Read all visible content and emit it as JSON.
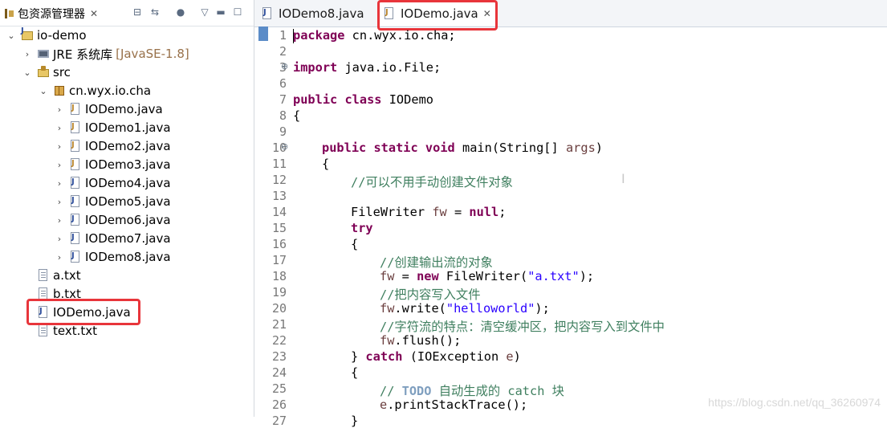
{
  "explorer": {
    "title": "包资源管理器",
    "tree": [
      {
        "label": "io-demo"
      },
      {
        "label": "JRE 系统库",
        "suffix": "[JavaSE-1.8]"
      },
      {
        "label": "src"
      },
      {
        "label": "cn.wyx.io.cha"
      },
      {
        "label": "IODemo.java"
      },
      {
        "label": "IODemo1.java"
      },
      {
        "label": "IODemo2.java"
      },
      {
        "label": "IODemo3.java"
      },
      {
        "label": "IODemo4.java"
      },
      {
        "label": "IODemo5.java"
      },
      {
        "label": "IODemo6.java"
      },
      {
        "label": "IODemo7.java"
      },
      {
        "label": "IODemo8.java"
      },
      {
        "label": "a.txt"
      },
      {
        "label": "b.txt"
      },
      {
        "label": "IODemo.java"
      },
      {
        "label": "text.txt"
      }
    ]
  },
  "editor": {
    "tabs": [
      {
        "label": "IODemo8.java"
      },
      {
        "label": "IODemo.java"
      }
    ],
    "line_numbers": [
      "1",
      "2",
      "3",
      "6",
      "7",
      "8",
      "9",
      "10",
      "11",
      "12",
      "13",
      "14",
      "15",
      "16",
      "17",
      "18",
      "19",
      "20",
      "21",
      "22",
      "23",
      "24",
      "25",
      "26",
      "27"
    ],
    "code": {
      "l1_kw": "package",
      "l1_rest": " cn.wyx.io.cha;",
      "l3_kw": "import",
      "l3_rest": " java.io.File;",
      "l7_kw": "public class",
      "l7_rest": " IODemo",
      "l8": "{",
      "l10_kw": "public static void",
      "l10_a": " main(String[] ",
      "l10_var": "args",
      "l10_b": ")",
      "l11": "{",
      "l12": "//可以不用手动创建文件对象",
      "l14_a": "FileWriter ",
      "l14_var": "fw",
      "l14_b": " = ",
      "l14_kw": "null",
      "l14_c": ";",
      "l15": "try",
      "l16": "{",
      "l17": "//创建输出流的对象",
      "l18_var": "fw",
      "l18_a": " = ",
      "l18_kw": "new",
      "l18_b": " FileWriter(",
      "l18_str": "\"a.txt\"",
      "l18_c": ");",
      "l19": "//把内容写入文件",
      "l20_var": "fw",
      "l20_a": ".write(",
      "l20_str": "\"helloworld\"",
      "l20_b": ");",
      "l21": "//字符流的特点：清空缓冲区，把内容写入到文件中",
      "l22_var": "fw",
      "l22_a": ".flush();",
      "l23_a": "} ",
      "l23_kw": "catch",
      "l23_b": " (IOException ",
      "l23_var": "e",
      "l23_c": ")",
      "l24": "{",
      "l25_a": "// ",
      "l25_todo": "TODO",
      "l25_b": " 自动生成的 catch 块",
      "l26_var": "e",
      "l26_a": ".printStackTrace();",
      "l27": "}"
    },
    "watermark": "https://blog.csdn.net/qq_36260974"
  },
  "colors": {
    "highlight_box": "#e8353b",
    "keyword": "#7f0055",
    "string": "#2a00ff",
    "comment": "#3f7f5f"
  }
}
